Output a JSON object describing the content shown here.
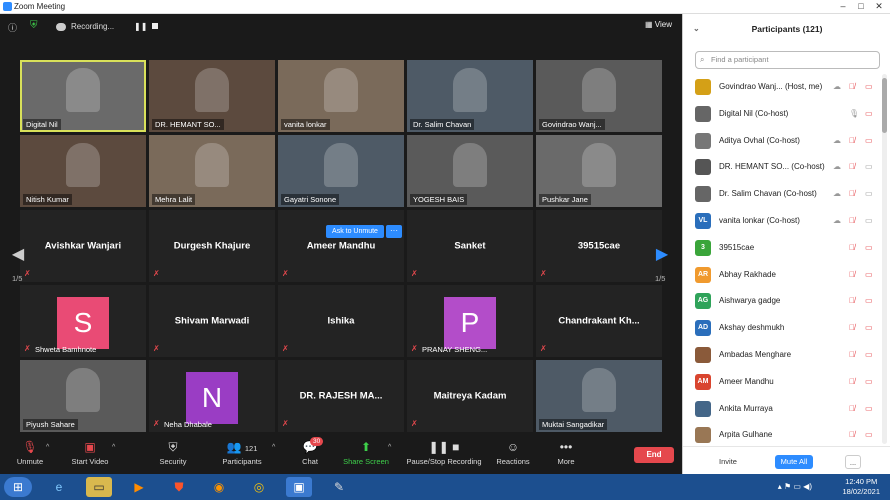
{
  "window": {
    "title": "Zoom Meeting"
  },
  "topbar": {
    "recording": "Recording...",
    "view": "View"
  },
  "grid": {
    "rows": [
      [
        {
          "name": "Digital Nil",
          "video": true,
          "active": true
        },
        {
          "name": "DR. HEMANT SO...",
          "video": true
        },
        {
          "name": "vanita lonkar",
          "video": true
        },
        {
          "name": "Dr. Salim Chavan",
          "video": true
        },
        {
          "name": "Govindrao Wanj...",
          "video": true
        }
      ],
      [
        {
          "name": "Nitish Kumar",
          "video": true
        },
        {
          "name": "Mehra Lalit",
          "video": true
        },
        {
          "name": "Gayatri Sonone",
          "video": true
        },
        {
          "name": "YOGESH BAIS",
          "video": true
        },
        {
          "name": "Pushkar Jane",
          "video": true
        }
      ],
      [
        {
          "name": "Avishkar Wanjari"
        },
        {
          "name": "Durgesh Khajure"
        },
        {
          "name": "Ameer Mandhu"
        },
        {
          "name": "Sanket"
        },
        {
          "name": "39515cae"
        }
      ],
      [
        {
          "name": "Shweta Bamhnote",
          "avatar": "S",
          "avatarColor": "#e94b75"
        },
        {
          "name": "Shivam Marwadi"
        },
        {
          "name": "Ishika"
        },
        {
          "name": "PRANAY SHENG...",
          "avatar": "P",
          "avatarColor": "#b34dc9"
        },
        {
          "name": "Chandrakant  Kh..."
        }
      ],
      [
        {
          "name": "Piyush Sahare",
          "video": true
        },
        {
          "name": "Neha Dhabale",
          "avatar": "N",
          "avatarColor": "#9a3dc4"
        },
        {
          "name": "DR. RAJESH MA..."
        },
        {
          "name": "Maitreya Kadam"
        },
        {
          "name": "Muktai Sangadikar",
          "video": true
        }
      ]
    ],
    "ask_unmute": "Ask to Unmute",
    "more": "···",
    "page_left": "1/5",
    "page_right": "1/5"
  },
  "toolbar": {
    "unmute": "Unmute",
    "start_video": "Start Video",
    "security": "Security",
    "participants": "Participants",
    "participants_count": "121",
    "chat": "Chat",
    "chat_badge": "30",
    "share_screen": "Share Screen",
    "pause_recording": "Pause/Stop Recording",
    "reactions": "Reactions",
    "more": "More",
    "end": "End"
  },
  "panel": {
    "title": "Participants (121)",
    "search_placeholder": "Find a participant",
    "participants": [
      {
        "name": "Govindrao Wanj...  (Host, me)",
        "initials": "",
        "color": "#d4a017",
        "photo": true,
        "mic": "muted",
        "video": "off",
        "cloud": true
      },
      {
        "name": "Digital Nil (Co-host)",
        "initials": "",
        "color": "#666",
        "photo": true,
        "mic": "on",
        "video": "off"
      },
      {
        "name": "Aditya Ovhal (Co-host)",
        "initials": "",
        "color": "#777",
        "photo": true,
        "mic": "muted",
        "video": "off",
        "cloud": true
      },
      {
        "name": "DR. HEMANT SO...  (Co-host)",
        "initials": "",
        "color": "#555",
        "photo": true,
        "mic": "muted",
        "video": "on",
        "cloud": true
      },
      {
        "name": "Dr. Salim Chavan (Co-host)",
        "initials": "",
        "color": "#666",
        "photo": true,
        "mic": "muted",
        "video": "on",
        "cloud": true
      },
      {
        "name": "vanita lonkar (Co-host)",
        "initials": "VL",
        "color": "#2a6ebb",
        "mic": "muted",
        "video": "on",
        "cloud": true
      },
      {
        "name": "39515cae",
        "initials": "3",
        "color": "#3aa53a",
        "mic": "muted",
        "video": "off"
      },
      {
        "name": "Abhay Rakhade",
        "initials": "AR",
        "color": "#f09a2e",
        "mic": "muted",
        "video": "off"
      },
      {
        "name": "Aishwarya gadge",
        "initials": "AG",
        "color": "#2fa35a",
        "mic": "muted",
        "video": "off"
      },
      {
        "name": "Akshay deshmukh",
        "initials": "AD",
        "color": "#2a6ebb",
        "mic": "muted",
        "video": "off"
      },
      {
        "name": "Ambadas Menghare",
        "initials": "",
        "color": "#8a5a3a",
        "photo": true,
        "mic": "muted",
        "video": "off"
      },
      {
        "name": "Ameer Mandhu",
        "initials": "AM",
        "color": "#d9452f",
        "mic": "muted",
        "video": "off"
      },
      {
        "name": "Ankita Murraya",
        "initials": "",
        "color": "#446688",
        "photo": true,
        "mic": "muted",
        "video": "off"
      },
      {
        "name": "Arpita Gulhane",
        "initials": "",
        "color": "#997755",
        "photo": true,
        "mic": "muted",
        "video": "off"
      }
    ],
    "invite": "Invite",
    "mute_all": "Mute All",
    "more": "..."
  },
  "taskbar": {
    "time": "12:40 PM",
    "date": "18/02/2021"
  },
  "colors": {
    "accent": "#2d8cff",
    "danger": "#e5484d",
    "share": "#3ecf4a"
  }
}
